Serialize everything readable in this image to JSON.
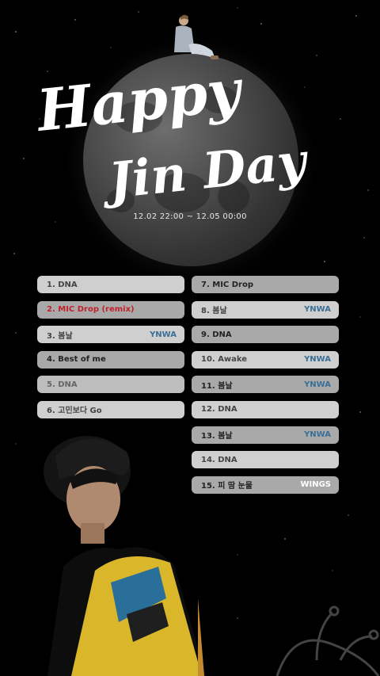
{
  "poster": {
    "title_line1": "Happy",
    "title_line2": "Jin Day",
    "date_range": "12.02 22:00 ~ 12.05 00:00"
  },
  "playlist_left": [
    {
      "title": "1. DNA",
      "tag": "",
      "style": "light"
    },
    {
      "title": "2. MIC Drop (remix)",
      "tag": "",
      "style": "mid",
      "highlight": true
    },
    {
      "title": "3. 봄날",
      "tag": "YNWA",
      "style": "light"
    },
    {
      "title": "4. Best of me",
      "tag": "",
      "style": "mid"
    },
    {
      "title": "5. DNA",
      "tag": "",
      "style": "dim"
    },
    {
      "title": "6. 고민보다 Go",
      "tag": "",
      "style": "light"
    }
  ],
  "playlist_right": [
    {
      "title": "7. MIC Drop",
      "tag": "",
      "style": "mid"
    },
    {
      "title": "8. 봄날",
      "tag": "YNWA",
      "style": "light"
    },
    {
      "title": "9. DNA",
      "tag": "",
      "style": "mid"
    },
    {
      "title": "10. Awake",
      "tag": "YNWA",
      "style": "light"
    },
    {
      "title": "11. 봄날",
      "tag": "YNWA",
      "style": "mid"
    },
    {
      "title": "12. DNA",
      "tag": "",
      "style": "light"
    },
    {
      "title": "13. 봄날",
      "tag": "YNWA",
      "style": "mid"
    },
    {
      "title": "14. DNA",
      "tag": "",
      "style": "light"
    },
    {
      "title": "15. 피 땀 눈물",
      "tag": "WINGS",
      "style": "mid",
      "tag_white": true
    }
  ],
  "colors": {
    "background": "#000000",
    "highlight_text": "#c2202a",
    "tag_blue": "#3a6f96"
  }
}
